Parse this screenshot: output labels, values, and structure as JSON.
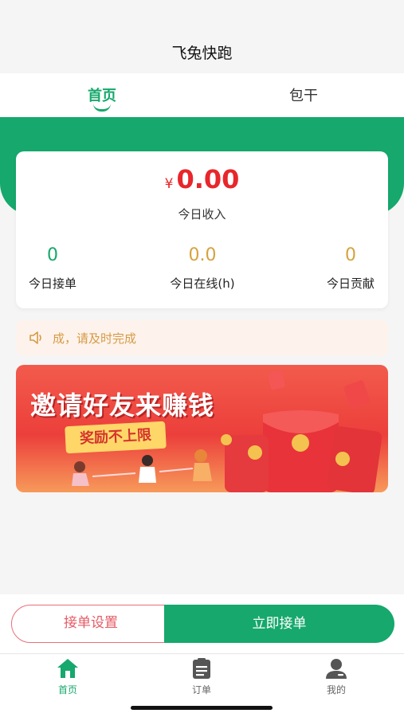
{
  "app": {
    "title": "飞兔快跑"
  },
  "tabs": [
    {
      "label": "首页",
      "active": true
    },
    {
      "label": "包干",
      "active": false
    }
  ],
  "income": {
    "currency": "¥",
    "amount": "0.00",
    "label": "今日收入"
  },
  "stats": [
    {
      "value": "0",
      "label": "今日接单",
      "color": "#16a86c"
    },
    {
      "value": "0.0",
      "label": "今日在线(h)",
      "color": "#d7a23f"
    },
    {
      "value": "0",
      "label": "今日贡献",
      "color": "#d7a23f"
    }
  ],
  "notice": {
    "icon": "speaker-icon",
    "text": "成，请及时完成"
  },
  "banner": {
    "title": "邀请好友来赚钱",
    "subtitle": "奖励不上限"
  },
  "actions": {
    "settings_label": "接单设置",
    "accept_label": "立即接单"
  },
  "tabbar": [
    {
      "label": "首页",
      "icon": "home-icon",
      "active": true
    },
    {
      "label": "订单",
      "icon": "clipboard-icon",
      "active": false
    },
    {
      "label": "我的",
      "icon": "user-icon",
      "active": false
    }
  ],
  "colors": {
    "primary": "#16a86c",
    "accent_red": "#e8262b",
    "gold": "#d7a23f"
  }
}
